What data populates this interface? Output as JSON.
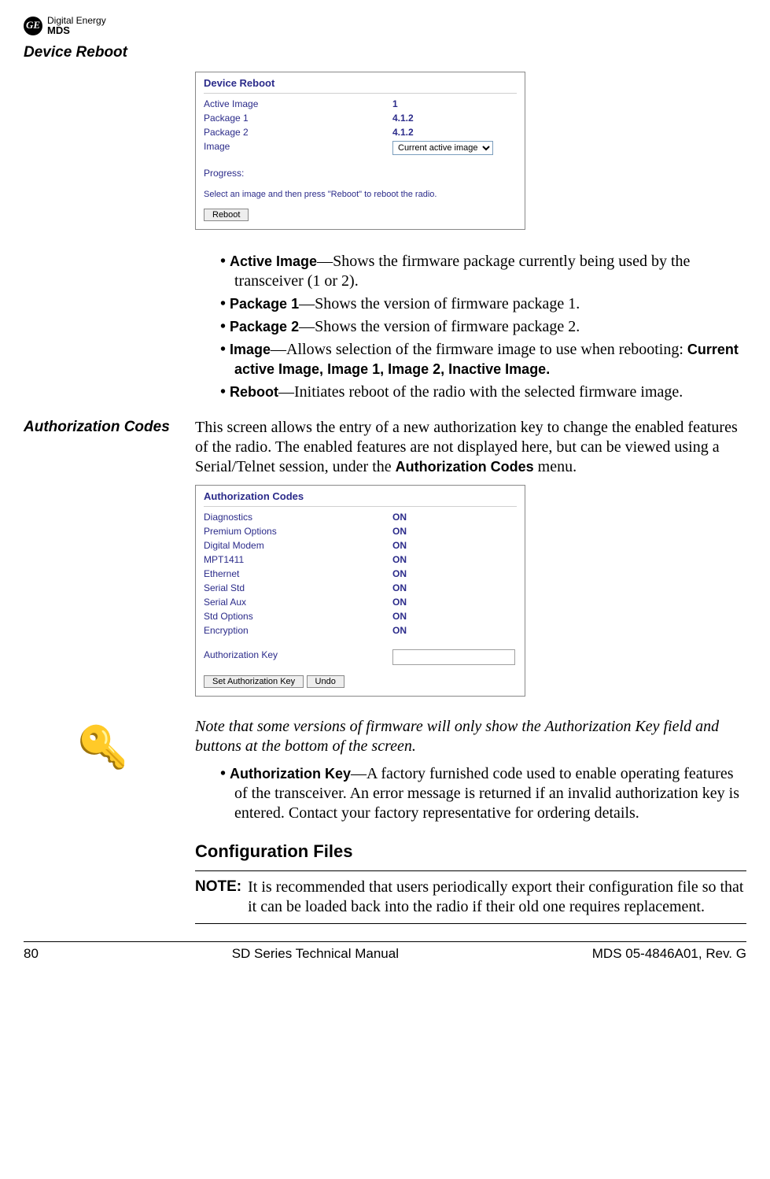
{
  "logo": {
    "line1": "Digital Energy",
    "line2": "MDS",
    "mono": "GE"
  },
  "sections": {
    "device_reboot_title": "Device Reboot",
    "auth_codes_title": "Authorization Codes",
    "config_files_title": "Configuration Files"
  },
  "panel1": {
    "title": "Device Reboot",
    "rows": {
      "active_image_lbl": "Active Image",
      "active_image_val": "1",
      "pkg1_lbl": "Package 1",
      "pkg1_val": "4.1.2",
      "pkg2_lbl": "Package 2",
      "pkg2_val": "4.1.2",
      "image_lbl": "Image",
      "image_select": "Current active image",
      "progress_lbl": "Progress:",
      "instr": "Select an image and then press \"Reboot\" to reboot the radio.",
      "reboot_btn": "Reboot"
    }
  },
  "bullets1": {
    "b1a": "Active Image",
    "b1b": "—Shows the firmware package currently being used by the transceiver (1 or 2).",
    "b2a": "Package 1",
    "b2b": "—Shows the version of firmware package 1.",
    "b3a": "Package 2",
    "b3b": "—Shows the version of firmware package 2.",
    "b4a": "Image",
    "b4b": "—Allows selection of the firmware image to use when rebooting: ",
    "b4c": "Current active Image, Image 1, Image 2, Inactive Image.",
    "b5a": "Reboot",
    "b5b": "—Initiates reboot of the radio with the selected firmware image."
  },
  "auth_intro": {
    "p1a": "This screen allows the entry of a new authorization key to change the enabled features of the radio. The enabled features are not displayed here, but can be viewed using a Serial/Telnet session, under the ",
    "p1b": "Authorization Codes",
    "p1c": " menu."
  },
  "panel2": {
    "title": "Authorization Codes",
    "rows": [
      {
        "lbl": "Diagnostics",
        "val": "ON"
      },
      {
        "lbl": "Premium Options",
        "val": "ON"
      },
      {
        "lbl": "Digital Modem",
        "val": "ON"
      },
      {
        "lbl": "MPT1411",
        "val": "ON"
      },
      {
        "lbl": "Ethernet",
        "val": "ON"
      },
      {
        "lbl": "Serial Std",
        "val": "ON"
      },
      {
        "lbl": "Serial Aux",
        "val": "ON"
      },
      {
        "lbl": "Std Options",
        "val": "ON"
      },
      {
        "lbl": "Encryption",
        "val": "ON"
      }
    ],
    "key_lbl": "Authorization Key",
    "set_btn": "Set Authorization Key",
    "undo_btn": "Undo"
  },
  "note_italic": "Note that some versions of firmware will only show the Authorization Key field and buttons at the bottom of the screen.",
  "bullets2": {
    "b1a": "Authorization Key",
    "b1b": "—A factory furnished code used to enable operating features of the transceiver. An error message is returned if an invalid authorization key is entered. Contact your factory representative for ordering details."
  },
  "note_block": {
    "label": "NOTE:",
    "text": "It is recommended that users periodically export their configuration file so that it can be loaded back into the radio if their old one requires replacement."
  },
  "footer": {
    "page": "80",
    "center": "SD Series Technical Manual",
    "right": "MDS 05-4846A01, Rev. G"
  }
}
